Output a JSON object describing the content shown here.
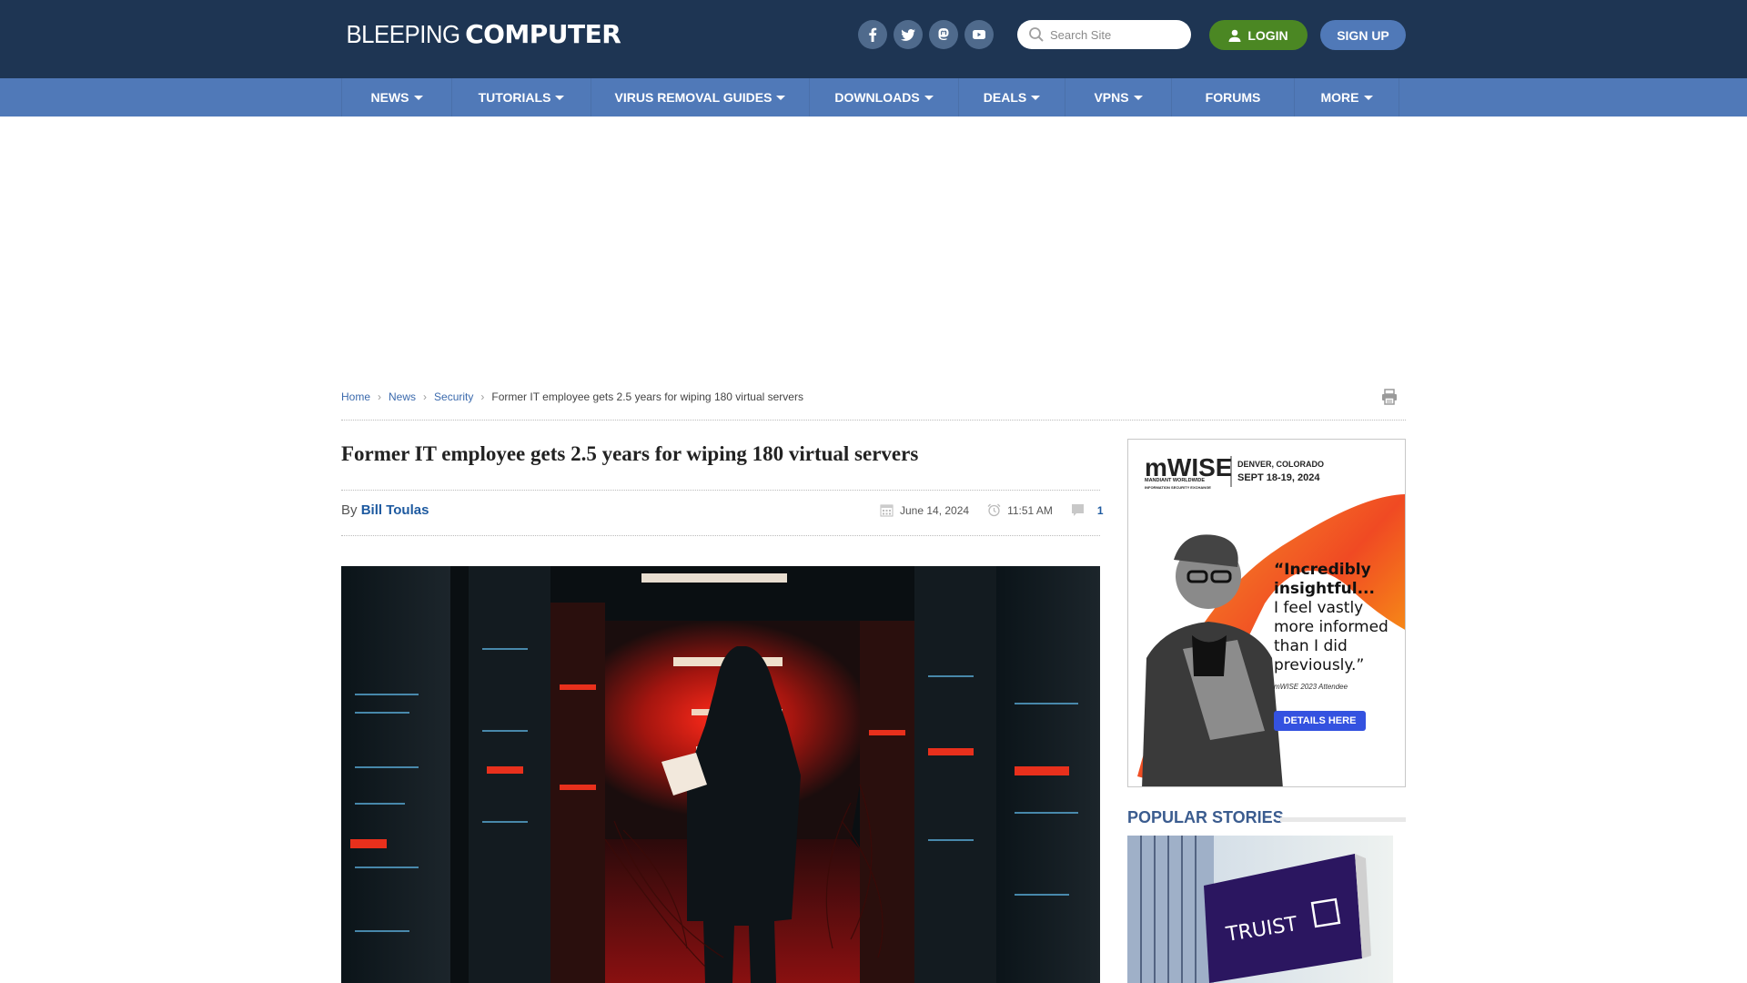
{
  "header": {
    "logo_light": "BLEEPING",
    "logo_bold": "COMPUTER",
    "social": [
      {
        "name": "facebook",
        "icon": "facebook-icon"
      },
      {
        "name": "twitter",
        "icon": "twitter-icon"
      },
      {
        "name": "mastodon",
        "icon": "mastodon-icon"
      },
      {
        "name": "youtube",
        "icon": "youtube-icon"
      }
    ],
    "search_placeholder": "Search Site",
    "search_value": "",
    "login_label": "LOGIN",
    "signup_label": "SIGN UP"
  },
  "nav": {
    "items": [
      {
        "label": "NEWS",
        "dropdown": true
      },
      {
        "label": "TUTORIALS",
        "dropdown": true
      },
      {
        "label": "VIRUS REMOVAL GUIDES",
        "dropdown": true
      },
      {
        "label": "DOWNLOADS",
        "dropdown": true
      },
      {
        "label": "DEALS",
        "dropdown": true
      },
      {
        "label": "VPNS",
        "dropdown": true
      },
      {
        "label": "FORUMS",
        "dropdown": false
      },
      {
        "label": "MORE",
        "dropdown": true
      }
    ]
  },
  "breadcrumb": {
    "items": [
      "Home",
      "News",
      "Security"
    ],
    "current": "Former IT employee gets 2.5 years for wiping 180 virtual servers"
  },
  "article": {
    "title": "Former IT employee gets 2.5 years for wiping 180 virtual servers",
    "by_label": "By",
    "author": "Bill Toulas",
    "date": "June 14, 2024",
    "time": "11:51 AM",
    "comment_count": "1",
    "hero_alt": "Hooded figure in red-lit server room"
  },
  "sidebar": {
    "ad": {
      "brand": "mWISE",
      "brand_sub1": "MANDIANT WORLDWIDE",
      "brand_sub2": "INFORMATION SECURITY EXCHANGE",
      "location": "DENVER, COLORADO",
      "dates": "SEPT 18-19, 2024",
      "quote_lines": [
        "“Incredibly",
        "insightful...",
        "I feel vastly",
        "more informed",
        "than I did",
        "previously.”"
      ],
      "attribution": "mWISE 2023 Attendee",
      "cta": "DETAILS HERE"
    },
    "popular_title": "POPULAR STORIES",
    "popular_image_text": "TRUIST"
  },
  "colors": {
    "header_bg": "#1e3553",
    "nav_bg": "#5079b8",
    "login_green": "#4b8723",
    "link_blue": "#1e5aa0",
    "popular_title": "#3b5c8f",
    "ad_cta": "#3452e0"
  }
}
